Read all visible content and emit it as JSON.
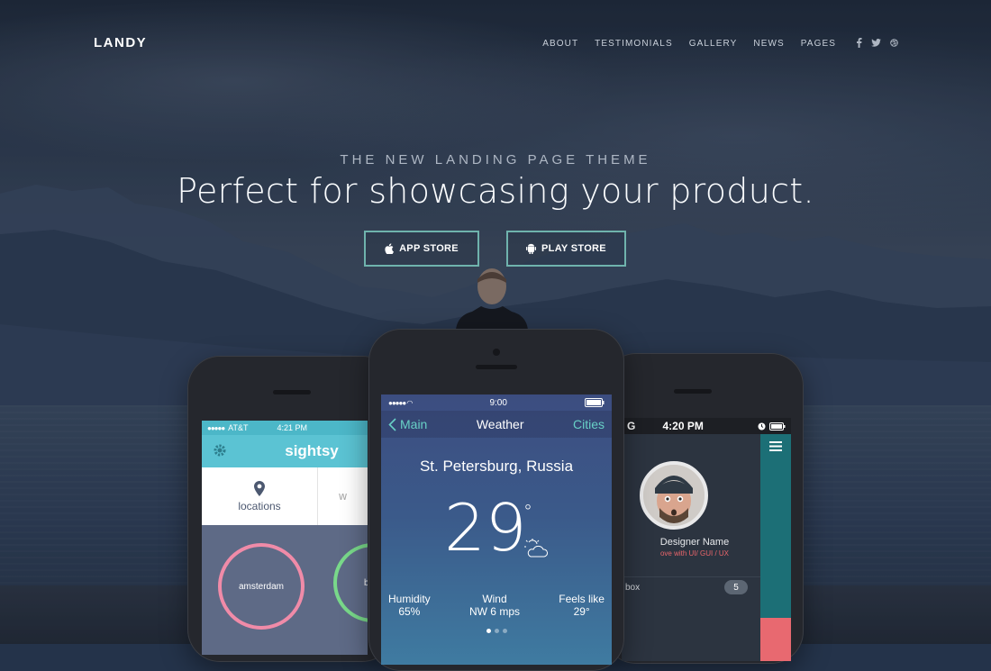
{
  "brand": "LANDY",
  "nav": {
    "items": [
      "ABOUT",
      "TESTIMONIALS",
      "GALLERY",
      "NEWS",
      "PAGES"
    ],
    "social_icons": [
      "facebook-icon",
      "twitter-icon",
      "dribbble-icon"
    ]
  },
  "hero": {
    "kicker": "THE NEW LANDING PAGE THEME",
    "headline": "Perfect for showcasing your product.",
    "app_store_label": "APP STORE",
    "play_store_label": "PLAY STORE"
  },
  "colors": {
    "accent": "#6fb3ad",
    "sightsy_header": "#5bc3d3",
    "weather_link": "#68d0c6",
    "profile_accent": "#e9656a"
  },
  "left_phone": {
    "carrier": "AT&T",
    "time": "4:21 PM",
    "app_name": "sightsy",
    "tab_locations": "locations",
    "tab_other_fragment": "w",
    "circle_1": "amsterdam",
    "circle_2_fragment": "b"
  },
  "center_phone": {
    "time": "9:00",
    "back_label": "Main",
    "title": "Weather",
    "right_label": "Cities",
    "city": "St. Petersburg, Russia",
    "temperature": "29",
    "degree": "°",
    "stats": [
      {
        "label": "Humidity",
        "value": "65%"
      },
      {
        "label": "Wind",
        "value": "NW 6 mps"
      },
      {
        "label": "Feels like",
        "value": "29°"
      }
    ]
  },
  "right_phone": {
    "carrier_fragment": "G",
    "time": "4:20 PM",
    "name": "Designer Name",
    "role": "ove with UI/ GUI / UX",
    "inbox_label": "box",
    "inbox_count": "5"
  }
}
